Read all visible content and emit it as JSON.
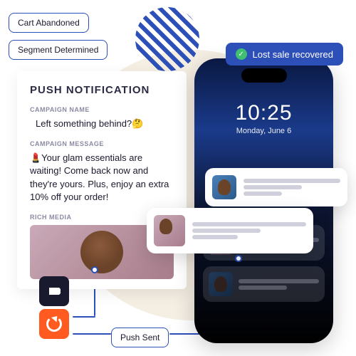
{
  "chips": {
    "cart_abandoned": "Cart Abandoned",
    "segment_determined": "Segment Determined",
    "push_sent": "Push Sent",
    "lost_sale": "Lost sale recovered"
  },
  "card": {
    "title": "PUSH NOTIFICATION",
    "campaign_name_label": "CAMPAIGN NAME",
    "campaign_name": "Left something behind?🤔",
    "campaign_message_label": "CAMPAIGN MESSAGE",
    "campaign_message": "💄Your glam essentials are waiting! Come back now and they're yours. Plus, enjoy an extra 10% off your order!",
    "rich_media_label": "RICH MEDIA"
  },
  "phone": {
    "time": "10:25",
    "date": "Monday, June 6"
  },
  "icons": {
    "klaviyo": "klaviyo-flag-icon",
    "refresh": "refresh-icon"
  }
}
